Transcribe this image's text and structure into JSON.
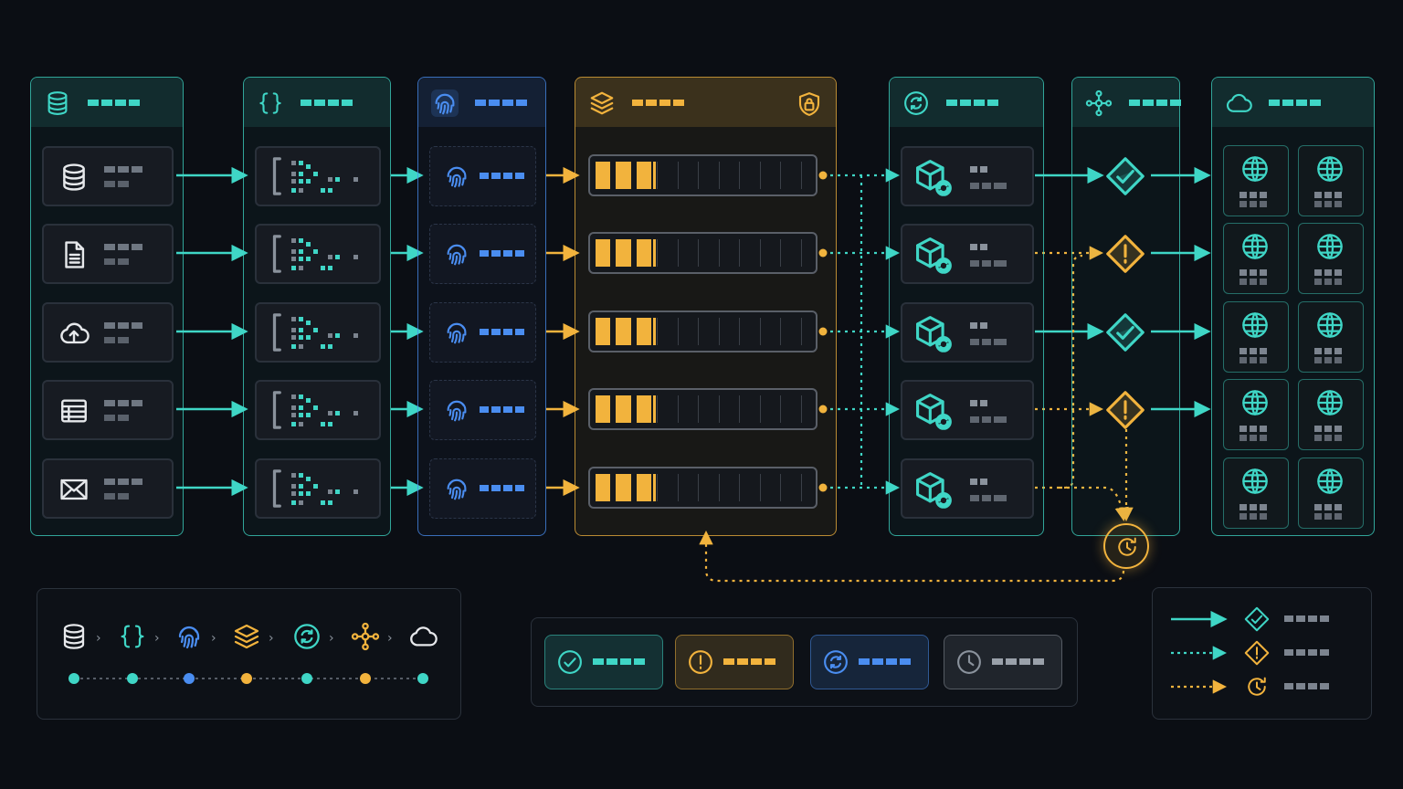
{
  "colors": {
    "teal": "#3fd6c6",
    "blue": "#4a8df0",
    "amber": "#f2b33d",
    "gray": "#8a929c",
    "bg": "#0b0e14"
  },
  "columns": [
    {
      "id": "sources",
      "icon": "database-icon",
      "accent": "teal",
      "rows": [
        "database-icon",
        "document-icon",
        "cloud-upload-icon",
        "table-icon",
        "mail-icon"
      ]
    },
    {
      "id": "parse",
      "icon": "braces-icon",
      "accent": "teal",
      "rows": [
        "bracket-code-icon",
        "bracket-code-icon",
        "bracket-code-icon",
        "bracket-code-icon",
        "bracket-code-icon"
      ]
    },
    {
      "id": "identify",
      "icon": "fingerprint-icon",
      "accent": "blue",
      "rows": [
        "fingerprint-icon",
        "fingerprint-icon",
        "fingerprint-icon",
        "fingerprint-icon",
        "fingerprint-icon"
      ]
    },
    {
      "id": "queue",
      "icon": "layers-icon",
      "badge_icon": "lock-shield-icon",
      "accent": "amber",
      "row_fill": [
        3,
        3,
        3,
        3,
        3
      ],
      "row_slots": 11
    },
    {
      "id": "process",
      "icon": "sync-circle-icon",
      "accent": "teal",
      "rows": [
        "cube-refresh-icon",
        "cube-refresh-icon",
        "cube-refresh-icon",
        "cube-refresh-icon",
        "cube-refresh-icon"
      ]
    },
    {
      "id": "validate",
      "icon": "network-hub-icon",
      "accent": "teal",
      "rows": [
        "check-diamond-icon",
        "warning-diamond-icon",
        "check-diamond-icon",
        "warning-diamond-icon"
      ]
    },
    {
      "id": "deploy",
      "icon": "cloud-icon",
      "accent": "teal",
      "rows": [
        "globe-icon",
        "globe-icon",
        "globe-icon",
        "globe-icon",
        "globe-icon",
        "globe-icon",
        "globe-icon",
        "globe-icon",
        "globe-icon",
        "globe-icon"
      ]
    }
  ],
  "retry_node": {
    "icon": "retry-clock-icon",
    "accent": "amber"
  },
  "flow_legend": {
    "steps": [
      "database-icon",
      "braces-icon",
      "fingerprint-icon",
      "layers-icon",
      "sync-circle-icon",
      "network-hub-icon",
      "cloud-icon"
    ],
    "dot_colors": [
      "teal",
      "teal",
      "blue",
      "amber",
      "teal",
      "amber",
      "teal"
    ]
  },
  "status_chips": [
    {
      "icon": "check-circle-icon",
      "accent": "teal"
    },
    {
      "icon": "warning-circle-icon",
      "accent": "amber"
    },
    {
      "icon": "sync-circle-icon",
      "accent": "blue"
    },
    {
      "icon": "clock-icon",
      "accent": "gray"
    }
  ],
  "line_legend": [
    {
      "line": "solid",
      "accent": "teal",
      "icon": "check-diamond-icon"
    },
    {
      "line": "dotted",
      "accent": "teal",
      "icon": "warning-diamond-icon"
    },
    {
      "line": "dotted",
      "accent": "amber",
      "icon": "retry-clock-icon"
    }
  ]
}
